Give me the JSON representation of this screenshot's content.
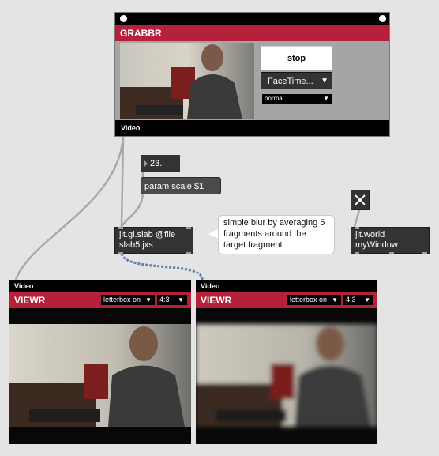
{
  "grabbr": {
    "title": "GRABBR",
    "footer": "Video",
    "stop_label": "stop",
    "camera_value": "FaceTime...",
    "mode_value": "normal"
  },
  "number_box": {
    "value": "23."
  },
  "message_box": {
    "text": "param scale $1"
  },
  "slab_object": {
    "line1": "jit.gl.slab @file",
    "line2": "slab5.jxs"
  },
  "comment": {
    "text": "simple blur by averaging 5 fragments around the target fragment"
  },
  "world_object": {
    "line1": "jit.world",
    "line2": "myWindow"
  },
  "viewers": [
    {
      "label": "Video",
      "title": "VIEWR",
      "letterbox": "letterbox on",
      "aspect": "4:3"
    },
    {
      "label": "Video",
      "title": "VIEWR",
      "letterbox": "letterbox on",
      "aspect": "4:3"
    }
  ],
  "colors": {
    "module_header": "#b5203a",
    "object_bg": "#333333",
    "patch_bg": "#e4e4e4"
  }
}
